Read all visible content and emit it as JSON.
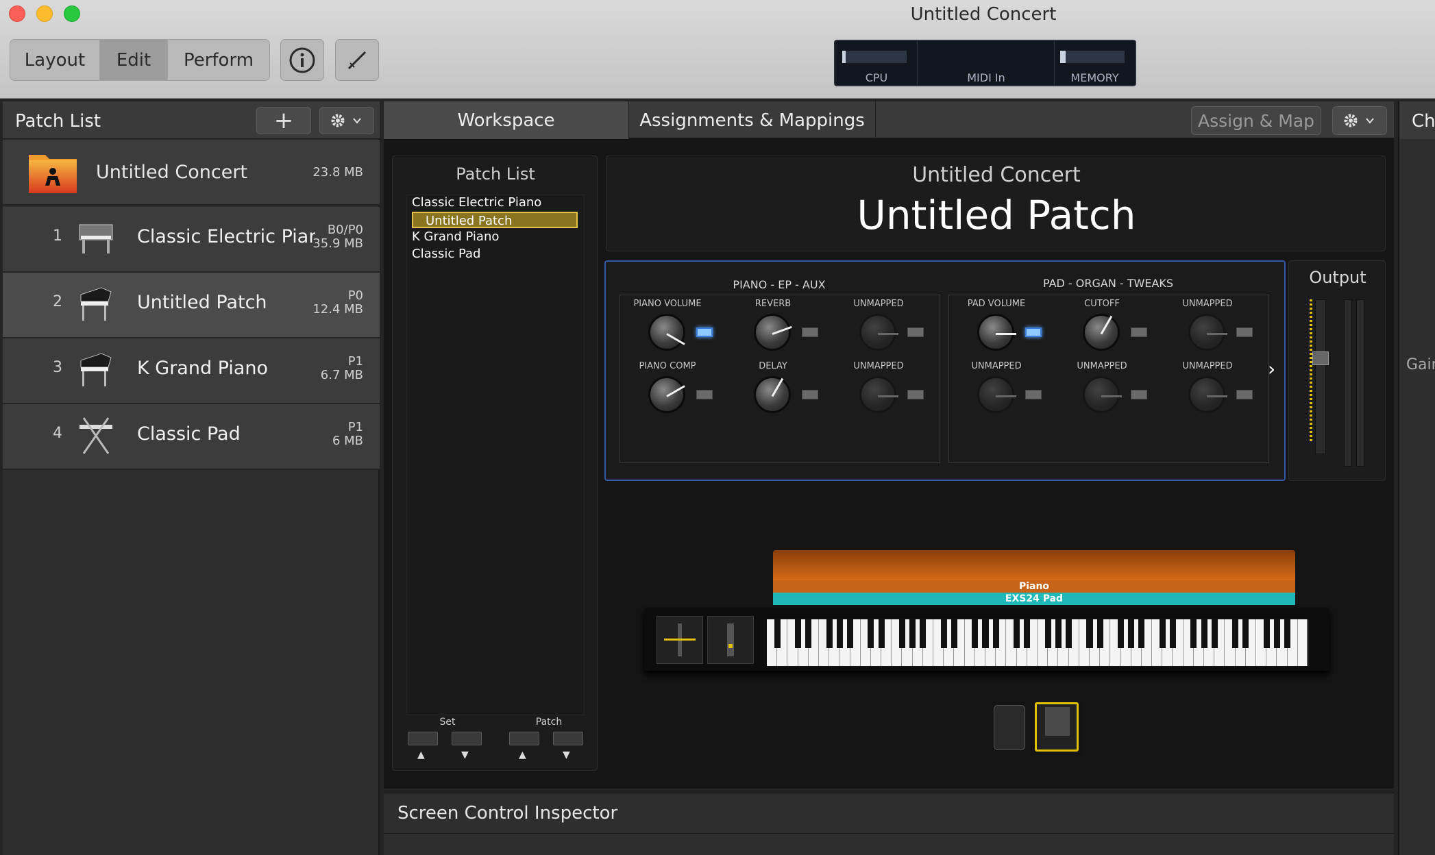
{
  "window": {
    "title": "Untitled Concert"
  },
  "toolbar": {
    "segments": [
      "Layout",
      "Edit",
      "Perform"
    ],
    "info_icon": "info-icon",
    "tuner_icon": "tuner-icon"
  },
  "meters": {
    "cpu_label": "CPU",
    "cpu_level": 0.05,
    "midi_label": "MIDI In",
    "memory_label": "MEMORY",
    "memory_level": 0.09
  },
  "patch_list": {
    "title": "Patch List",
    "concert": {
      "name": "Untitled Concert",
      "size": "23.8 MB"
    },
    "items": [
      {
        "num": "1",
        "name": "Classic Electric Piano",
        "program": "B0/P0",
        "size": "35.9 MB"
      },
      {
        "num": "2",
        "name": "Untitled Patch",
        "program": "P0",
        "size": "12.4 MB"
      },
      {
        "num": "3",
        "name": "K Grand Piano",
        "program": "P1",
        "size": "6.7 MB"
      },
      {
        "num": "4",
        "name": "Classic Pad",
        "program": "P1",
        "size": "6 MB"
      }
    ]
  },
  "tabs": {
    "workspace": "Workspace",
    "assignments": "Assignments & Mappings",
    "assign_map": "Assign & Map"
  },
  "workspace": {
    "list_title": "Patch List",
    "list_items": [
      "Classic Electric Piano",
      "Untitled Patch",
      "K Grand Piano",
      "Classic Pad"
    ],
    "set_label": "Set",
    "patch_label": "Patch",
    "concert_name": "Untitled Concert",
    "patch_name": "Untitled Patch",
    "group1_title": "PIANO - EP - AUX",
    "group2_title": "PAD - ORGAN - TWEAKS",
    "knobs1": [
      "PIANO VOLUME",
      "REVERB",
      "UNMAPPED",
      "PIANO COMP",
      "DELAY",
      "UNMAPPED"
    ],
    "knobs2": [
      "PAD VOLUME",
      "CUTOFF",
      "UNMAPPED",
      "UNMAPPED",
      "UNMAPPED",
      "UNMAPPED"
    ],
    "output_label": "Output",
    "layer1": "Piano",
    "layer2": "EXS24 Pad"
  },
  "inspector": {
    "title": "Screen Control Inspector"
  },
  "right_strip": {
    "title": "Ch",
    "gain": "Gain"
  },
  "colors": {
    "accent_orange": "#c8641a",
    "accent_teal": "#1fb8b8",
    "select_gold": "#8b7420"
  }
}
